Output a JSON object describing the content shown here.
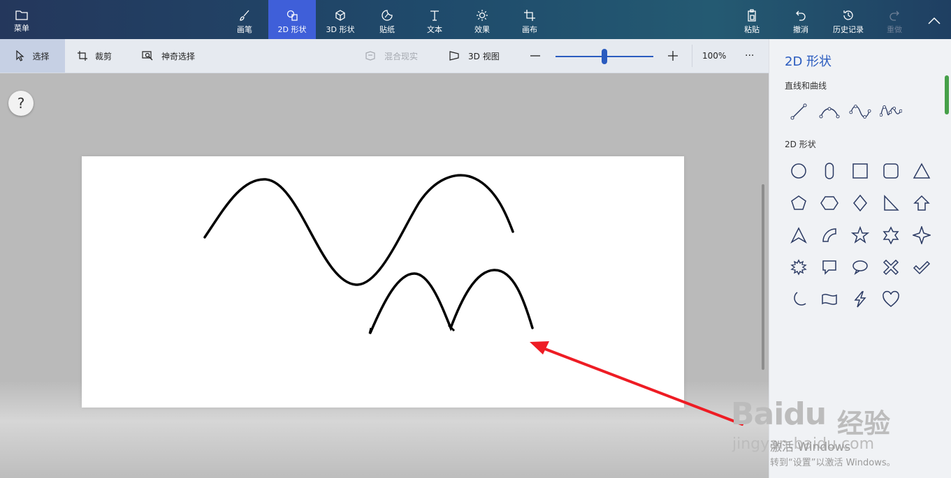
{
  "topbar": {
    "menu_label": "菜单",
    "tools": [
      {
        "label": "画笔",
        "icon": "brush-icon"
      },
      {
        "label": "2D 形状",
        "icon": "2d-shapes-icon"
      },
      {
        "label": "3D 形状",
        "icon": "3d-cube-icon"
      },
      {
        "label": "贴纸",
        "icon": "sticker-icon"
      },
      {
        "label": "文本",
        "icon": "text-icon"
      },
      {
        "label": "效果",
        "icon": "effects-icon"
      },
      {
        "label": "画布",
        "icon": "canvas-icon"
      }
    ],
    "actions": {
      "paste": "粘贴",
      "undo": "撤消",
      "history": "历史记录",
      "redo": "重做"
    },
    "colors": {
      "active_tab": "#3f5fd9"
    }
  },
  "toolbar2": {
    "select": "选择",
    "crop": "裁剪",
    "magic_select": "神奇选择",
    "mixed_reality": "混合现实",
    "view_3d": "3D 视图",
    "zoom_value": "100%",
    "zoom_slider_fraction": 0.5,
    "more": "···"
  },
  "canvas": {
    "help": "?"
  },
  "panel": {
    "title": "2D 形状",
    "lines_section": "直线和曲线",
    "shapes_section": "2D 形状",
    "line_tools": [
      "line-icon",
      "curve-icon",
      "two-point-curve-icon",
      "three-point-curve-icon"
    ],
    "shapes": [
      "circle-icon",
      "capsule-icon",
      "square-icon",
      "rounded-square-icon",
      "triangle-icon",
      "pentagon-icon",
      "hexagon-icon",
      "diamond-icon",
      "right-triangle-icon",
      "arrow-up-icon",
      "arrowhead-icon",
      "quarter-circle-icon",
      "star-5-icon",
      "star-6-icon",
      "star-4-icon",
      "burst-icon",
      "speech-bubble-icon",
      "thought-bubble-icon",
      "cross-icon",
      "checkmark-icon",
      "moon-icon",
      "banner-icon",
      "lightning-icon",
      "heart-icon"
    ]
  },
  "watermark": {
    "baidu": "Baidu",
    "jingyan": "经验",
    "url": "jingyan.baidu.com",
    "activate_title": "激活 Windows",
    "activate_sub": "转到“设置”以激活 Windows。"
  }
}
